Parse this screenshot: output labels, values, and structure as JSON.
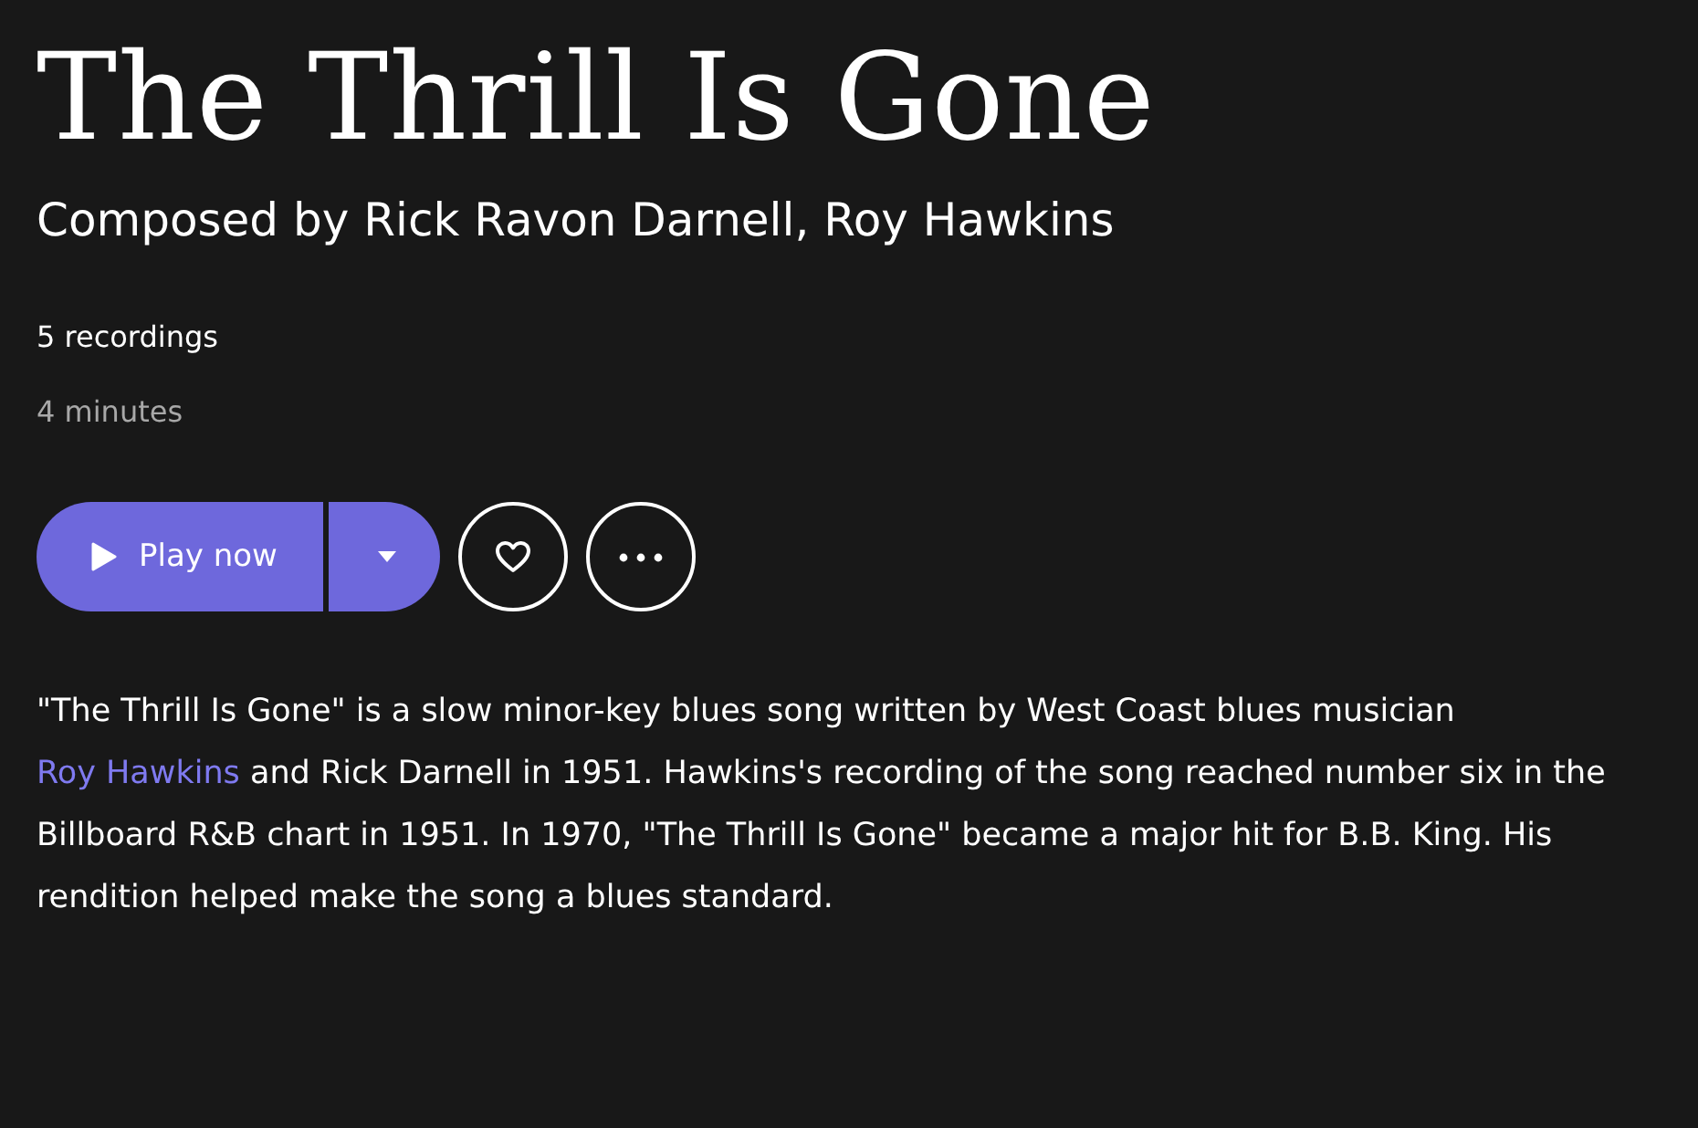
{
  "title": "The Thrill Is Gone",
  "composer": {
    "label": "Composed by",
    "names": [
      "Rick Ravon Darnell,",
      "Roy Hawkins"
    ]
  },
  "recordings": "5 recordings",
  "duration": "4 minutes",
  "actions": {
    "play": "Play now"
  },
  "description": [
    {
      "kind": "text",
      "text": "\"The Thrill Is Gone\" is a slow minor-key blues song written by West Coast blues musician "
    },
    {
      "kind": "link",
      "text": "Roy Hawkins"
    },
    {
      "kind": "text",
      "text": " and Rick Darnell in 1951. Hawkins's recording of the song reached number six in the Billboard R&B chart in 1951. In 1970, \"The Thrill Is Gone\" became a major hit for B.B. King. His rendition helped make the song a blues standard."
    }
  ]
}
